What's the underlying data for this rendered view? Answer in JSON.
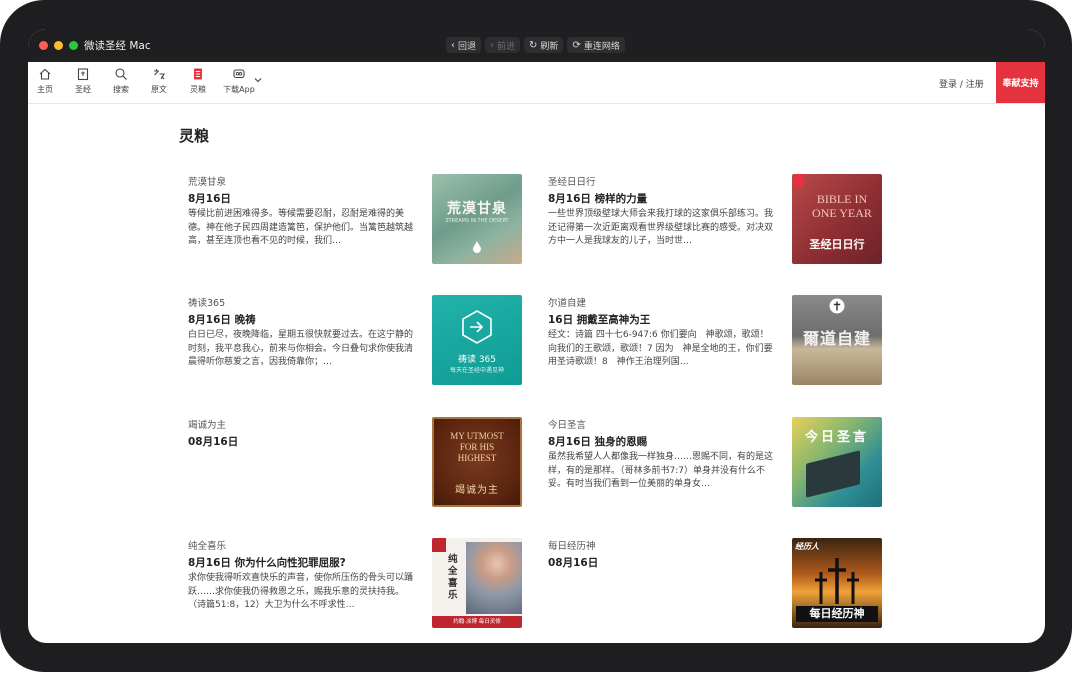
{
  "window": {
    "title": "微读圣经 Mac",
    "nav": {
      "back": "回退",
      "forward": "前进",
      "refresh": "刷新",
      "reconnect": "重连网络"
    }
  },
  "toolbar": {
    "items": [
      {
        "label": "主页",
        "icon": "home-icon"
      },
      {
        "label": "圣经",
        "icon": "bible-icon"
      },
      {
        "label": "搜索",
        "icon": "search-icon"
      },
      {
        "label": "原文",
        "icon": "original-text-icon"
      },
      {
        "label": "灵粮",
        "icon": "devotional-icon"
      },
      {
        "label": "下载App",
        "icon": "download-app-icon"
      }
    ],
    "login": "登录 / 注册",
    "donate": "奉献支持"
  },
  "colors": {
    "accent": "#e5323f",
    "titlebar": "#1f1f21"
  },
  "page": {
    "title": "灵粮"
  },
  "cards": [
    {
      "category": "荒漠甘泉",
      "title": "8月16日",
      "summary": "等候比前进困难得多。等候需要忍耐，忍耐是难得的美德。神在他子民四周建造篱笆，保护他们。当篱笆越筑越高，甚至连顶也看不见的时候，我们…",
      "thumb": {
        "line1": "荒漠甘泉",
        "line2": "STREAMS IN THE DESERT"
      }
    },
    {
      "category": "圣经日日行",
      "title": "8月16日 榜样的力量",
      "summary": "一些世界顶级壁球大师会来我打球的这家俱乐部练习。我还记得第一次近距离观看世界级壁球比赛的感受。对决双方中一人是我球友的儿子，当时世…",
      "thumb": {
        "line1": "BIBLE IN ONE YEAR",
        "line2": "圣经日日行"
      }
    },
    {
      "category": "祷读365",
      "title": "8月16日 晚祷",
      "summary": "白日已尽，夜晚降临，星期五很快就要过去。在这宁静的时刻，我平息我心，前来与你相会。今日叠句求你使我清晨得听你慈爱之言，因我倚靠你；…",
      "thumb": {
        "line1": "祷读 365",
        "line2": "每天在圣经中遇见神"
      }
    },
    {
      "category": "尔道自建",
      "title": "16日 拥戴至高神为王",
      "summary": "经文：诗篇 四十七6-947:6 你们要向　神歌颂，歌颂！向我们的王歌颂，歌颂！7 因为　神是全地的王，你们要用圣诗歌颂！8　神作王治理列国…",
      "thumb": {
        "line1": "爾道自建",
        "line2": ""
      }
    },
    {
      "category": "竭诚为主",
      "title": "08月16日",
      "summary": "",
      "thumb": {
        "line1": "MY UTMOST FOR HIS HIGHEST",
        "line2": "竭诚为主"
      }
    },
    {
      "category": "今日圣言",
      "title": "8月16日 独身的恩赐",
      "summary": "虽然我希望人人都像我一样独身……恩赐不同，有的是这样，有的是那样。（哥林多前书7:7）单身并没有什么不妥。有时当我们看到一位美丽的单身女…",
      "thumb": {
        "line1": "今日圣言",
        "line2": ""
      }
    },
    {
      "category": "纯全喜乐",
      "title": "8月16日 你为什么向性犯罪屈服?",
      "summary": "求你使我得听欢喜快乐的声音，使你所压伤的骨头可以踊跃……求你使我仍得救恩之乐，赐我乐意的灵扶持我。（诗篇51:8，12）大卫为什么不呼求性…",
      "thumb": {
        "line1": "纯全喜乐",
        "line2": "约翰·派博 每日灵修"
      }
    },
    {
      "category": "每日经历神",
      "title": "08月16日",
      "summary": "",
      "thumb": {
        "line1": "每日经历神",
        "line2": "经历人"
      }
    }
  ]
}
